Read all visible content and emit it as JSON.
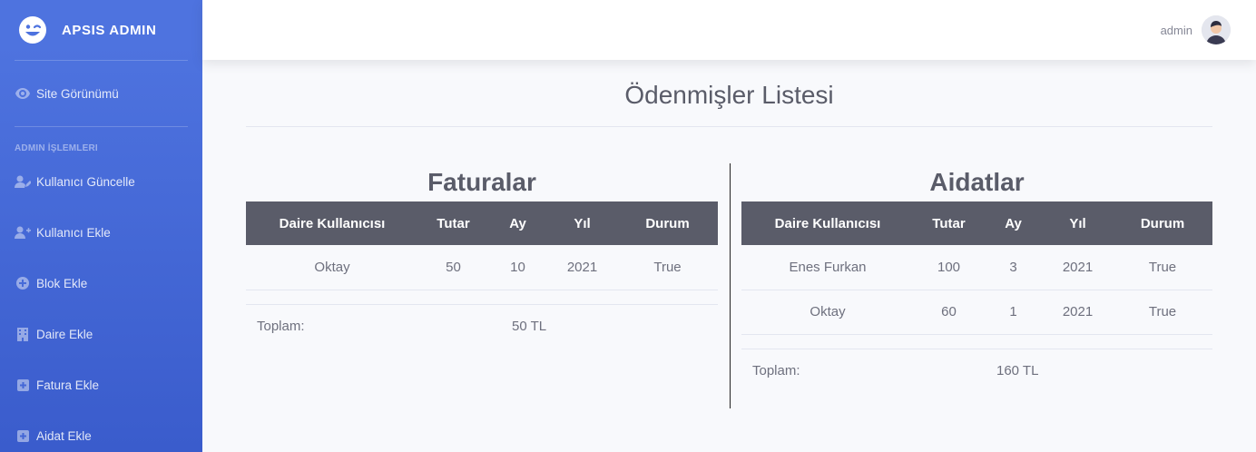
{
  "brand": {
    "name": "APSIS ADMIN",
    "icon": "laugh-wink-icon"
  },
  "topbar": {
    "user": "admin",
    "avatar_icon": "user-avatar"
  },
  "sidebar": {
    "site_link": "Site Görünümü",
    "heading": "ADMIN İŞLEMLERI",
    "items": [
      {
        "label": "Kullanıcı Güncelle",
        "icon": "user-edit-icon"
      },
      {
        "label": "Kullanıcı Ekle",
        "icon": "user-plus-icon"
      },
      {
        "label": "Blok Ekle",
        "icon": "plus-circle-icon"
      },
      {
        "label": "Daire Ekle",
        "icon": "building-icon"
      },
      {
        "label": "Fatura Ekle",
        "icon": "plus-square-icon"
      },
      {
        "label": "Aidat Ekle",
        "icon": "plus-square-icon"
      }
    ]
  },
  "page": {
    "title": "Ödenmişler Listesi"
  },
  "faturalar": {
    "title": "Faturalar",
    "headers": [
      "Daire Kullanıcısı",
      "Tutar",
      "Ay",
      "Yıl",
      "Durum"
    ],
    "rows": [
      [
        "Oktay",
        "50",
        "10",
        "2021",
        "True"
      ]
    ],
    "total_label": "Toplam:",
    "total_value": "50 TL"
  },
  "aidatlar": {
    "title": "Aidatlar",
    "headers": [
      "Daire Kullanıcısı",
      "Tutar",
      "Ay",
      "Yıl",
      "Durum"
    ],
    "rows": [
      [
        "Enes Furkan",
        "100",
        "3",
        "2021",
        "True"
      ],
      [
        "Oktay",
        "60",
        "1",
        "2021",
        "True"
      ]
    ],
    "total_label": "Toplam:",
    "total_value": "160 TL"
  },
  "colors": {
    "sidebar": "#4e73df",
    "table_header": "#5a5c69",
    "background": "#f8f9fc"
  }
}
